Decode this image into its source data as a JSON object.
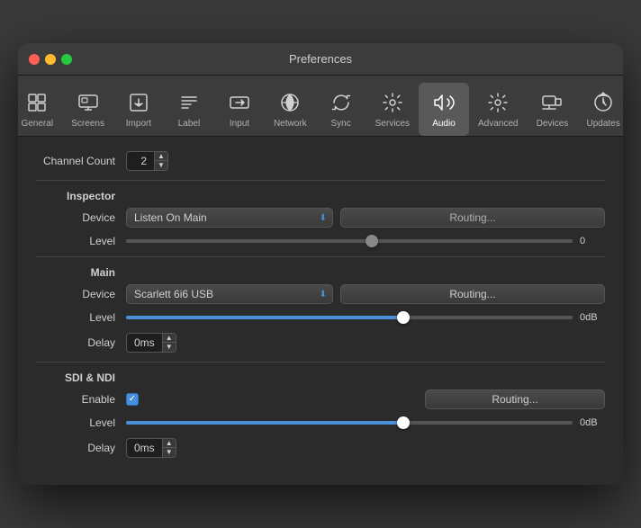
{
  "window": {
    "title": "Preferences"
  },
  "toolbar": {
    "items": [
      {
        "id": "general",
        "label": "General",
        "icon": "general"
      },
      {
        "id": "screens",
        "label": "Screens",
        "icon": "screens"
      },
      {
        "id": "import",
        "label": "Import",
        "icon": "import"
      },
      {
        "id": "label",
        "label": "Label",
        "icon": "label"
      },
      {
        "id": "input",
        "label": "Input",
        "icon": "input"
      },
      {
        "id": "network",
        "label": "Network",
        "icon": "network"
      },
      {
        "id": "sync",
        "label": "Sync",
        "icon": "sync"
      },
      {
        "id": "services",
        "label": "Services",
        "icon": "services"
      },
      {
        "id": "audio",
        "label": "Audio",
        "icon": "audio",
        "active": true
      },
      {
        "id": "advanced",
        "label": "Advanced",
        "icon": "advanced"
      },
      {
        "id": "devices",
        "label": "Devices",
        "icon": "devices"
      },
      {
        "id": "updates",
        "label": "Updates",
        "icon": "updates"
      }
    ]
  },
  "content": {
    "channel_count_label": "Channel Count",
    "channel_count_value": "2",
    "inspector_label": "Inspector",
    "inspector_device_label": "Device",
    "inspector_device_value": "Listen On Main",
    "inspector_routing_label": "Routing...",
    "inspector_level_label": "Level",
    "inspector_level_value": "0",
    "main_label": "Main",
    "main_device_label": "Device",
    "main_device_value": "Scarlett 6i6 USB",
    "main_routing_label": "Routing...",
    "main_level_label": "Level",
    "main_level_value": "0dB",
    "main_delay_label": "Delay",
    "main_delay_value": "0ms",
    "sdi_ndi_label": "SDI & NDI",
    "sdi_enable_label": "Enable",
    "sdi_routing_label": "Routing...",
    "sdi_level_label": "Level",
    "sdi_level_value": "0dB",
    "sdi_delay_label": "Delay",
    "sdi_delay_value": "0ms"
  }
}
